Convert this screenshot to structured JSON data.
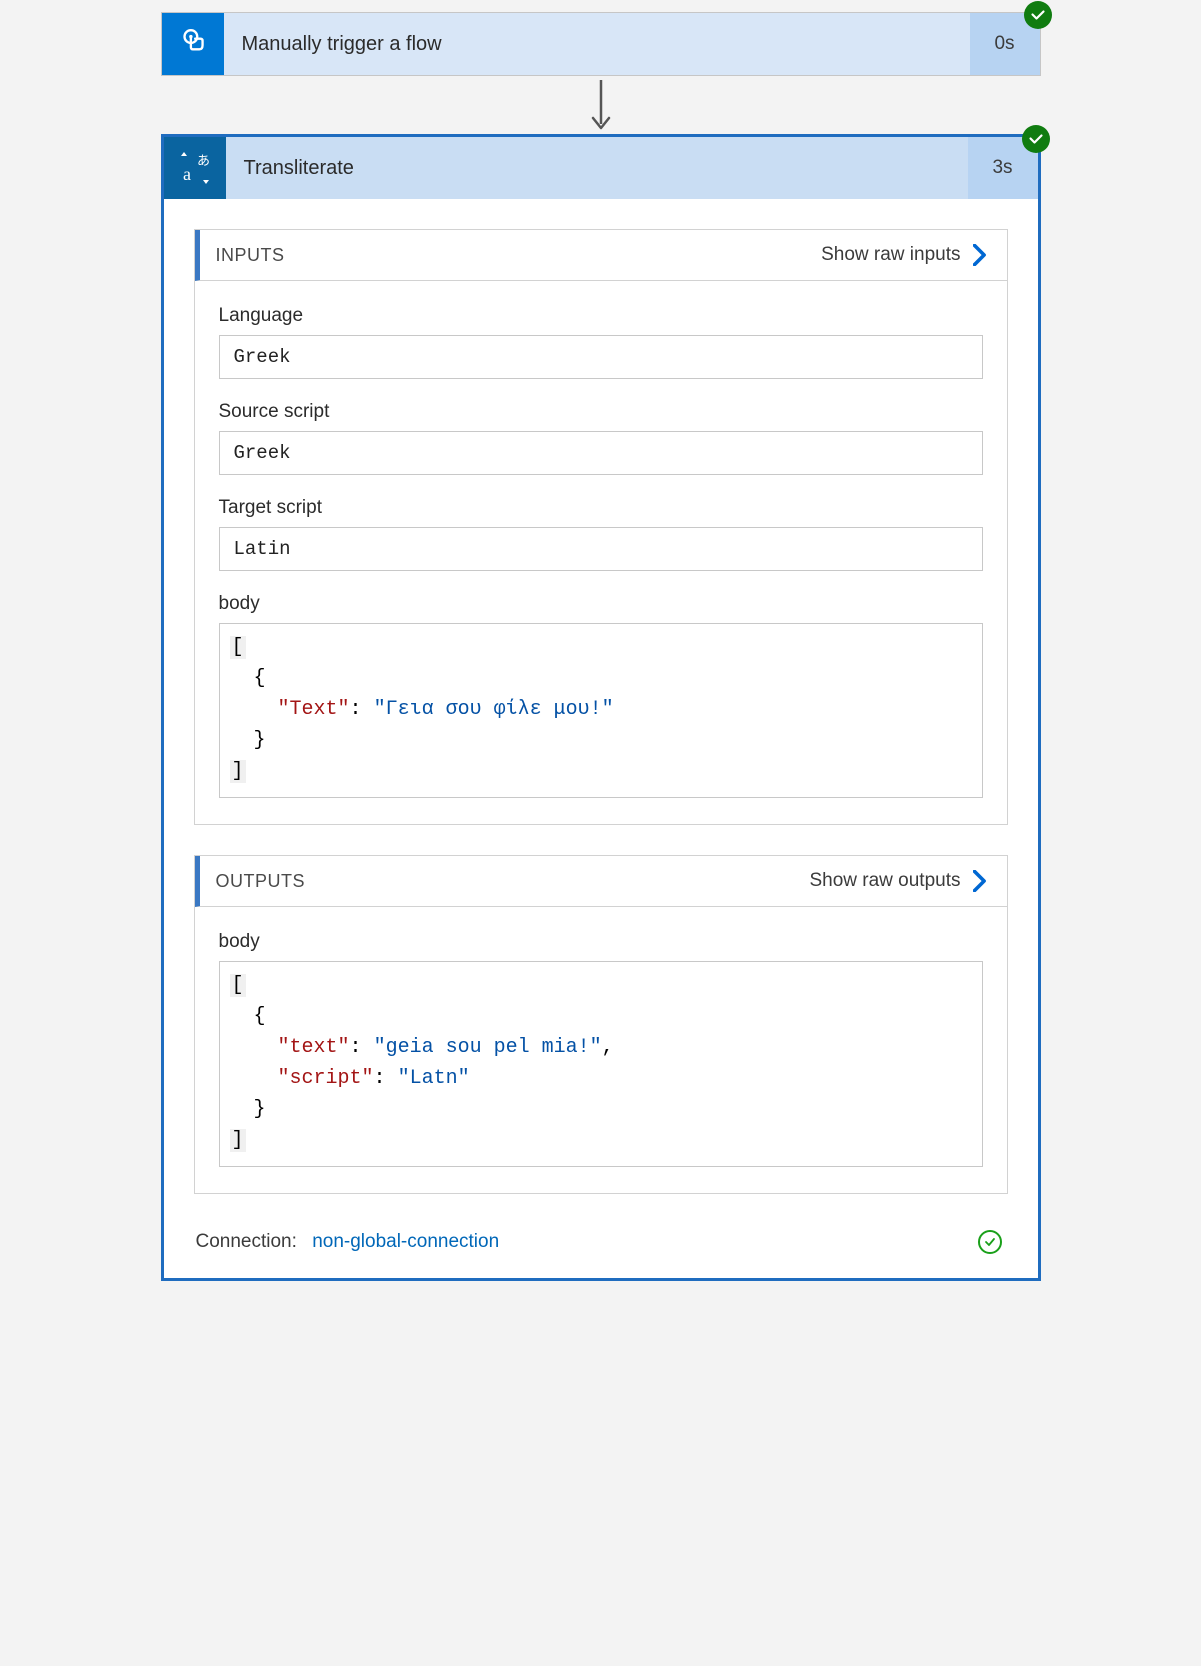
{
  "trigger": {
    "title": "Manually trigger a flow",
    "duration": "0s"
  },
  "action": {
    "title": "Transliterate",
    "duration": "3s"
  },
  "inputs": {
    "header": "INPUTS",
    "show_link": "Show raw inputs",
    "language_label": "Language",
    "language_value": "Greek",
    "source_label": "Source script",
    "source_value": "Greek",
    "target_label": "Target script",
    "target_value": "Latin",
    "body_label": "body",
    "body_json": {
      "key": "\"Text\"",
      "val": "\"Γεια σου φίλε μου!\""
    }
  },
  "outputs": {
    "header": "OUTPUTS",
    "show_link": "Show raw outputs",
    "body_label": "body",
    "body_json": {
      "text_key": "\"text\"",
      "text_val": "\"geia sou pel mia!\"",
      "script_key": "\"script\"",
      "script_val": "\"Latn\""
    }
  },
  "connection": {
    "label": "Connection:",
    "name": "non-global-connection"
  }
}
